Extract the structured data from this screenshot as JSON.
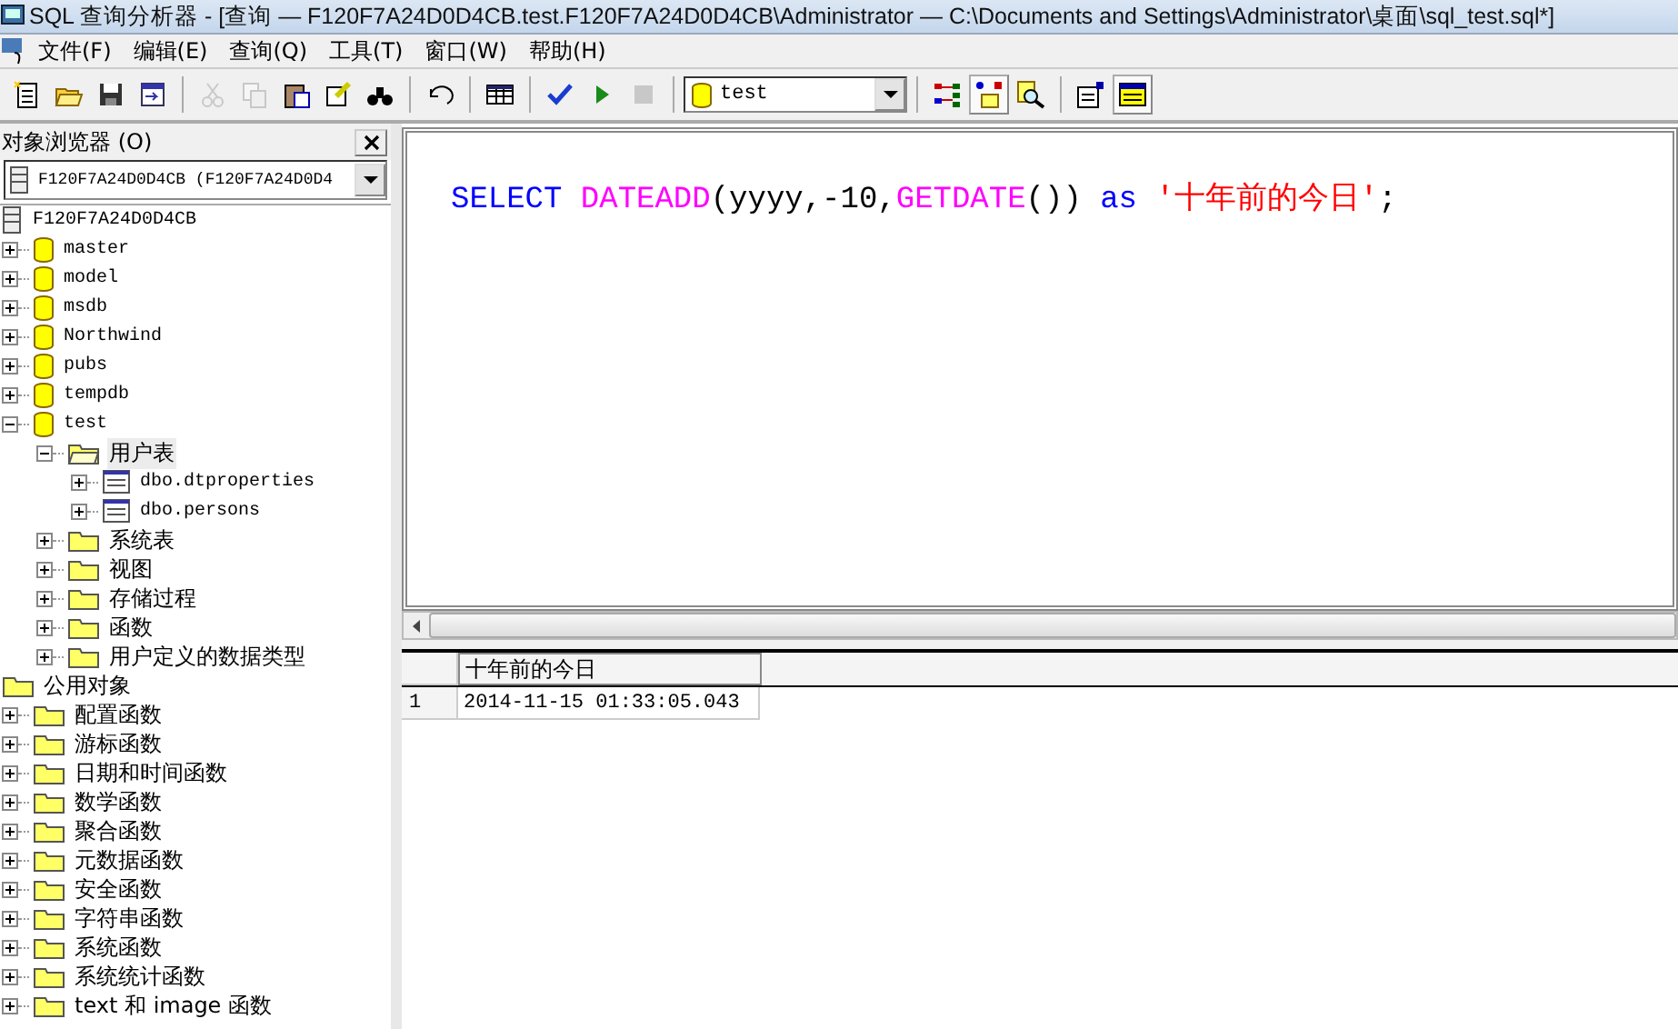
{
  "window": {
    "title": "SQL 查询分析器 - [查询 — F120F7A24D0D4CB.test.F120F7A24D0D4CB\\Administrator — C:\\Documents and Settings\\Administrator\\桌面\\sql_test.sql*]"
  },
  "menu": [
    "文件(F)",
    "编辑(E)",
    "查询(Q)",
    "工具(T)",
    "窗口(W)",
    "帮助(H)"
  ],
  "toolbar": {
    "buttons": [
      {
        "disabled": false
      },
      {
        "disabled": false
      },
      {
        "disabled": false
      },
      {
        "disabled": false
      },
      {
        "disabled": true
      },
      {
        "disabled": true
      },
      {
        "disabled": false
      },
      {
        "disabled": false
      },
      {
        "disabled": false
      },
      {
        "disabled": false
      },
      {
        "disabled": false
      },
      {
        "disabled": false
      },
      {
        "disabled": false
      },
      {
        "disabled": true
      },
      {
        "disabled": false,
        "pressed": false
      },
      {
        "disabled": false,
        "pressed": true
      },
      {
        "disabled": false,
        "pressed": false
      },
      {
        "disabled": false,
        "pressed": false
      },
      {
        "disabled": false,
        "pressed": true
      }
    ],
    "database": "test"
  },
  "object_browser": {
    "title": "对象浏览器 (O)",
    "server": "F120F7A24D0D4CB (F120F7A24D0D4",
    "tree": [
      {
        "label": "F120F7A24D0D4CB",
        "kind": "server",
        "selected": false,
        "children": [
          {
            "label": "master",
            "kind": "database",
            "expanded": false,
            "selected": false
          },
          {
            "label": "model",
            "kind": "database",
            "expanded": false,
            "selected": false
          },
          {
            "label": "msdb",
            "kind": "database",
            "expanded": false,
            "selected": false
          },
          {
            "label": "Northwind",
            "kind": "database",
            "expanded": false,
            "selected": false
          },
          {
            "label": "pubs",
            "kind": "database",
            "expanded": false,
            "selected": false
          },
          {
            "label": "tempdb",
            "kind": "database",
            "expanded": false,
            "selected": false
          },
          {
            "label": "test",
            "kind": "database",
            "expanded": true,
            "selected": false,
            "children": [
              {
                "label": "用户表",
                "kind": "folder",
                "expanded": true,
                "selected": true,
                "children": [
                  {
                    "label": "dbo.dtproperties",
                    "kind": "table",
                    "expanded": false,
                    "selected": false
                  },
                  {
                    "label": "dbo.persons",
                    "kind": "table",
                    "expanded": false,
                    "selected": false
                  }
                ]
              },
              {
                "label": "系统表",
                "kind": "folder",
                "expanded": false,
                "selected": false
              },
              {
                "label": "视图",
                "kind": "folder",
                "expanded": false,
                "selected": false
              },
              {
                "label": "存储过程",
                "kind": "folder",
                "expanded": false,
                "selected": false
              },
              {
                "label": "函数",
                "kind": "folder",
                "expanded": false,
                "selected": false
              },
              {
                "label": "用户定义的数据类型",
                "kind": "folder",
                "expanded": false,
                "selected": false
              }
            ]
          }
        ]
      },
      {
        "label": "公用对象",
        "kind": "folder",
        "selected": false,
        "children": [
          {
            "label": "配置函数",
            "kind": "folder",
            "expanded": false,
            "selected": false
          },
          {
            "label": "游标函数",
            "kind": "folder",
            "expanded": false,
            "selected": false
          },
          {
            "label": "日期和时间函数",
            "kind": "folder",
            "expanded": false,
            "selected": false
          },
          {
            "label": "数学函数",
            "kind": "folder",
            "expanded": false,
            "selected": false
          },
          {
            "label": "聚合函数",
            "kind": "folder",
            "expanded": false,
            "selected": false
          },
          {
            "label": "元数据函数",
            "kind": "folder",
            "expanded": false,
            "selected": false
          },
          {
            "label": "安全函数",
            "kind": "folder",
            "expanded": false,
            "selected": false
          },
          {
            "label": "字符串函数",
            "kind": "folder",
            "expanded": false,
            "selected": false
          },
          {
            "label": "系统函数",
            "kind": "folder",
            "expanded": false,
            "selected": false
          },
          {
            "label": "系统统计函数",
            "kind": "folder",
            "expanded": false,
            "selected": false
          },
          {
            "label": "text 和 image 函数",
            "kind": "folder",
            "expanded": false,
            "selected": false
          }
        ]
      }
    ]
  },
  "editor": {
    "tokens": [
      {
        "text": "SELECT ",
        "kind": "keyword"
      },
      {
        "text": "DATEADD",
        "kind": "function"
      },
      {
        "text": "(yyyy,-10,",
        "kind": "plain"
      },
      {
        "text": "GETDATE",
        "kind": "function"
      },
      {
        "text": "()) ",
        "kind": "plain"
      },
      {
        "text": "as ",
        "kind": "keyword"
      },
      {
        "text": "'十年前的今日'",
        "kind": "string"
      },
      {
        "text": ";",
        "kind": "plain"
      }
    ]
  },
  "results": {
    "columns": [
      "十年前的今日"
    ],
    "rows": [
      {
        "number": "1",
        "cells": [
          "2014-11-15 01:33:05.043"
        ]
      }
    ]
  }
}
